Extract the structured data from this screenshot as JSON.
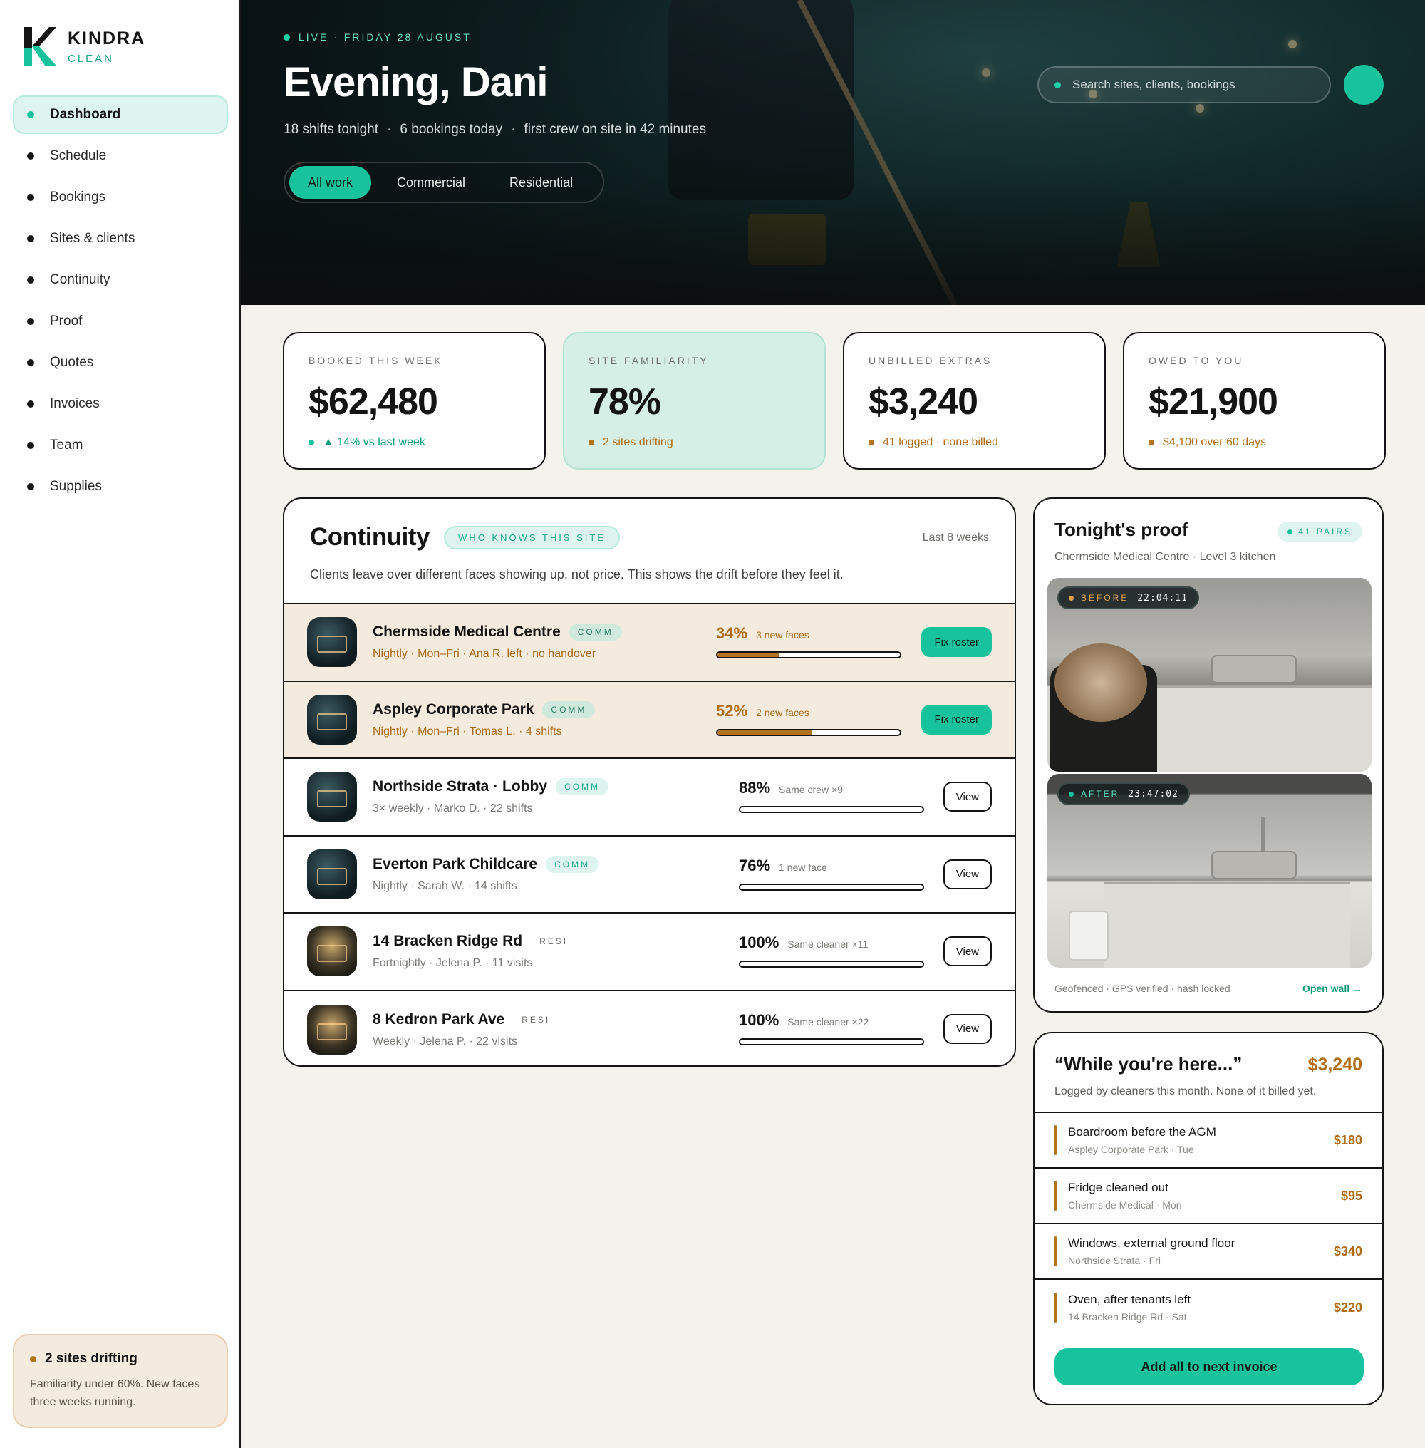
{
  "brand": {
    "name": "KINDRA",
    "sub": "CLEAN",
    "colors": {
      "accent": "#17c39d",
      "amber": "#b3741f",
      "ink": "#141414"
    }
  },
  "sidebar": {
    "items": [
      {
        "label": "Dashboard",
        "active": true
      },
      {
        "label": "Schedule"
      },
      {
        "label": "Bookings"
      },
      {
        "label": "Sites & clients"
      },
      {
        "label": "Continuity"
      },
      {
        "label": "Proof"
      },
      {
        "label": "Quotes"
      },
      {
        "label": "Invoices"
      },
      {
        "label": "Team"
      },
      {
        "label": "Supplies"
      }
    ],
    "alert": {
      "title": "2 sites drifting",
      "text": "Familiarity under 60%. New faces three weeks running."
    }
  },
  "hero": {
    "eyebrow": "LIVE · FRIDAY 28 AUGUST",
    "greeting": "Evening, Dani",
    "summary": [
      "18 shifts tonight",
      "6 bookings today",
      "first crew on site in 42 minutes"
    ],
    "filters": [
      "All work",
      "Commercial",
      "Residential"
    ],
    "search_placeholder": "Search sites, clients, bookings"
  },
  "stats": [
    {
      "label": "BOOKED THIS WEEK",
      "value": "$62,480",
      "note": "▲ 14% vs last week",
      "tone": "green"
    },
    {
      "label": "SITE FAMILIARITY",
      "value": "78%",
      "note": "2 sites drifting",
      "tone": "amber"
    },
    {
      "label": "UNBILLED EXTRAS",
      "value": "$3,240",
      "note": "41 logged · none billed",
      "tone": "amber"
    },
    {
      "label": "OWED TO YOU",
      "value": "$21,900",
      "note": "$4,100 over 60 days",
      "tone": "amber"
    }
  ],
  "continuity": {
    "title": "Continuity",
    "pill": "WHO KNOWS THIS SITE",
    "range": "Last 8 weeks",
    "description": "Clients leave over different faces showing up, not price. This shows the drift before they feel it.",
    "rows": [
      {
        "name": "Chermside Medical Centre",
        "tag": "COMM",
        "sub": "Nightly · Mon–Fri  ·  Ana R. left · no handover",
        "pct": "34%",
        "fill": 0.34,
        "note": "3 new faces",
        "action": "Fix roster",
        "warn": true
      },
      {
        "name": "Aspley Corporate Park",
        "tag": "COMM",
        "sub": "Nightly · Mon–Fri  ·  Tomas L. · 4 shifts",
        "pct": "52%",
        "fill": 0.52,
        "note": "2 new faces",
        "action": "Fix roster",
        "warn": true
      },
      {
        "name": "Northside Strata · Lobby",
        "tag": "COMM",
        "sub": "3× weekly  ·  Marko D. · 22 shifts",
        "pct": "88%",
        "fill": 0.88,
        "note": "Same crew ×9",
        "action": "View"
      },
      {
        "name": "Everton Park Childcare",
        "tag": "COMM",
        "sub": "Nightly  ·  Sarah W. · 14 shifts",
        "pct": "76%",
        "fill": 0.76,
        "note": "1 new face",
        "action": "View"
      },
      {
        "name": "14 Bracken Ridge Rd",
        "tag": "RESI",
        "sub": "Fortnightly  ·  Jelena P. · 11 visits",
        "pct": "100%",
        "fill": 1.0,
        "note": "Same cleaner ×11",
        "action": "View"
      },
      {
        "name": "8 Kedron Park Ave",
        "tag": "RESI",
        "sub": "Weekly  ·  Jelena P. · 22 visits",
        "pct": "100%",
        "fill": 1.0,
        "note": "Same cleaner ×22",
        "action": "View"
      }
    ]
  },
  "proof": {
    "title": "Tonight's proof",
    "pill": "41 PAIRS",
    "site": "Chermside Medical Centre · Level 3 kitchen",
    "before": {
      "label": "BEFORE",
      "time": "22:04:11"
    },
    "after": {
      "label": "AFTER",
      "time": "23:47:02"
    },
    "footer": "Geofenced · GPS verified · hash locked",
    "link": "Open wall →"
  },
  "extras": {
    "title": "“While you're here...”",
    "amount": "$3,240",
    "description": "Logged by cleaners this month. None of it billed yet.",
    "items": [
      {
        "title": "Boardroom before the AGM",
        "sub": "Aspley Corporate Park · Tue",
        "price": "$180"
      },
      {
        "title": "Fridge cleaned out",
        "sub": "Chermside Medical · Mon",
        "price": "$95"
      },
      {
        "title": "Windows, external ground floor",
        "sub": "Northside Strata · Fri",
        "price": "$340"
      },
      {
        "title": "Oven, after tenants left",
        "sub": "14 Bracken Ridge Rd · Sat",
        "price": "$220"
      }
    ],
    "cta": "Add all to next invoice"
  }
}
